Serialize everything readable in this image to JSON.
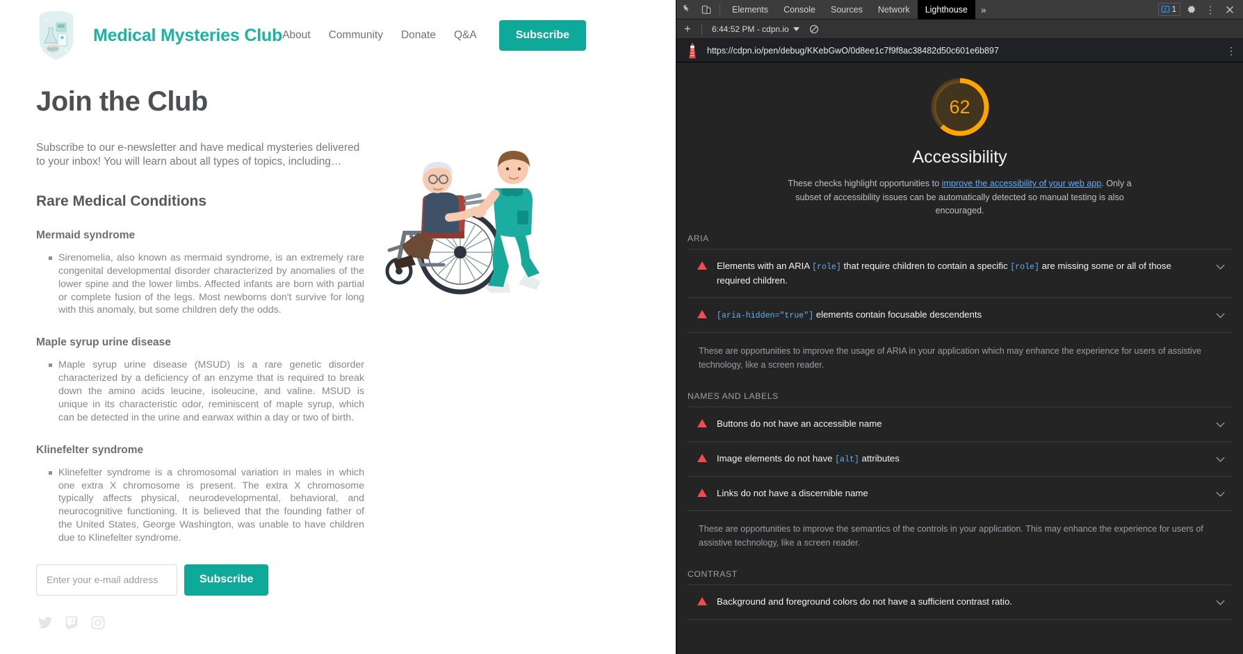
{
  "site": {
    "brand": "Medical Mysteries Club",
    "logo_icon": "medical-shield-logo-icon",
    "nav": [
      {
        "label": "About"
      },
      {
        "label": "Community"
      },
      {
        "label": "Donate"
      },
      {
        "label": "Q&A"
      }
    ],
    "header_cta": "Subscribe",
    "accent_color": "#0fa99a",
    "brand_color": "#18b5a0",
    "page_title": "Join the Club",
    "intro": "Subscribe to our e-newsletter and have medical mysteries delivered to your inbox! You will learn about all types of topics, including…",
    "section_title": "Rare Medical Conditions",
    "conditions": [
      {
        "title": "Mermaid syndrome",
        "body": "Sirenomelia, also known as mermaid syndrome, is an extremely rare congenital developmental disorder characterized by anomalies of the lower spine and the lower limbs. Affected infants are born with partial or complete fusion of the legs. Most newborns don't survive for long with this anomaly, but some children defy the odds."
      },
      {
        "title": "Maple syrup urine disease",
        "body": "Maple syrup urine disease (MSUD) is a rare genetic disorder characterized by a deficiency of an enzyme that is required to break down the amino acids leucine, isoleucine, and valine. MSUD is unique in its characteristic odor, reminiscent of maple syrup, which can be detected in the urine and earwax within a day or two of birth."
      },
      {
        "title": "Klinefelter syndrome",
        "body": "Klinefelter syndrome is a chromosomal variation in males in which one extra X chromosome is present. The extra X chromosome typically affects physical, neurodevelopmental, behavioral, and neurocognitive functioning. It is believed that the founding father of the United States, George Washington, was unable to have children due to Klinefelter syndrome."
      }
    ],
    "form": {
      "email_value": "",
      "email_placeholder": "Enter your e-mail address",
      "submit_label": "Subscribe"
    },
    "socials": [
      {
        "name": "twitter-icon"
      },
      {
        "name": "twitch-icon"
      },
      {
        "name": "instagram-icon"
      }
    ],
    "illustration": "nurse-pushing-patient-in-wheelchair-illustration"
  },
  "devtools": {
    "toolbar": {
      "inspect_icon": "inspect-element-icon",
      "device_toolbar_icon": "device-toolbar-icon",
      "tabs": [
        {
          "label": "Elements",
          "active": false
        },
        {
          "label": "Console",
          "active": false
        },
        {
          "label": "Sources",
          "active": false
        },
        {
          "label": "Network",
          "active": false
        },
        {
          "label": "Lighthouse",
          "active": true
        }
      ],
      "more_tabs_label": "»",
      "issues_count": "1",
      "issues_icon": "issues-icon",
      "settings_icon": "gear-icon",
      "menu_icon": "kebab-menu-icon",
      "close_icon": "close-icon"
    },
    "subbar": {
      "add_icon": "plus-icon",
      "run_label": "6:44:52 PM - cdpn.io",
      "dropdown_icon": "chevron-down-icon",
      "clear_icon": "clear-no-entry-icon"
    },
    "urlbar": {
      "lighthouse_icon": "lighthouse-logo-icon",
      "url": "https://cdpn.io/pen/debug/KKebGwO/0d8ee1c7f9f8ac38482d50c601e6b897",
      "menu_icon": "kebab-menu-icon"
    },
    "report": {
      "score": "62",
      "score_max": 100,
      "score_color": "#ffa400",
      "category": "Accessibility",
      "description_pre": "These checks highlight opportunities to ",
      "description_link": "improve the accessibility of your web app",
      "description_post": ". Only a subset of accessibility issues can be automatically detected so manual testing is also encouraged.",
      "sections": [
        {
          "heading": "ARIA",
          "audits": [
            {
              "parts": [
                {
                  "t": "Elements with an ARIA ",
                  "code": false
                },
                {
                  "t": "[role]",
                  "code": true
                },
                {
                  "t": " that require children to contain a specific ",
                  "code": false
                },
                {
                  "t": "[role]",
                  "code": true
                },
                {
                  "t": " are missing some or all of those required children.",
                  "code": false
                }
              ],
              "severity": "fail"
            },
            {
              "parts": [
                {
                  "t": "[aria-hidden=\"true\"]",
                  "code": true
                },
                {
                  "t": " elements contain focusable descendents",
                  "code": false
                }
              ],
              "severity": "fail"
            }
          ],
          "note": "These are opportunities to improve the usage of ARIA in your application which may enhance the experience for users of assistive technology, like a screen reader."
        },
        {
          "heading": "NAMES AND LABELS",
          "audits": [
            {
              "parts": [
                {
                  "t": "Buttons do not have an accessible name",
                  "code": false
                }
              ],
              "severity": "fail"
            },
            {
              "parts": [
                {
                  "t": "Image elements do not have ",
                  "code": false
                },
                {
                  "t": "[alt]",
                  "code": true
                },
                {
                  "t": " attributes",
                  "code": false
                }
              ],
              "severity": "fail"
            },
            {
              "parts": [
                {
                  "t": "Links do not have a discernible name",
                  "code": false
                }
              ],
              "severity": "fail"
            }
          ],
          "note": "These are opportunities to improve the semantics of the controls in your application. This may enhance the experience for users of assistive technology, like a screen reader."
        },
        {
          "heading": "CONTRAST",
          "audits": [
            {
              "parts": [
                {
                  "t": "Background and foreground colors do not have a sufficient contrast ratio.",
                  "code": false
                }
              ],
              "severity": "fail"
            }
          ],
          "note": ""
        }
      ]
    }
  }
}
